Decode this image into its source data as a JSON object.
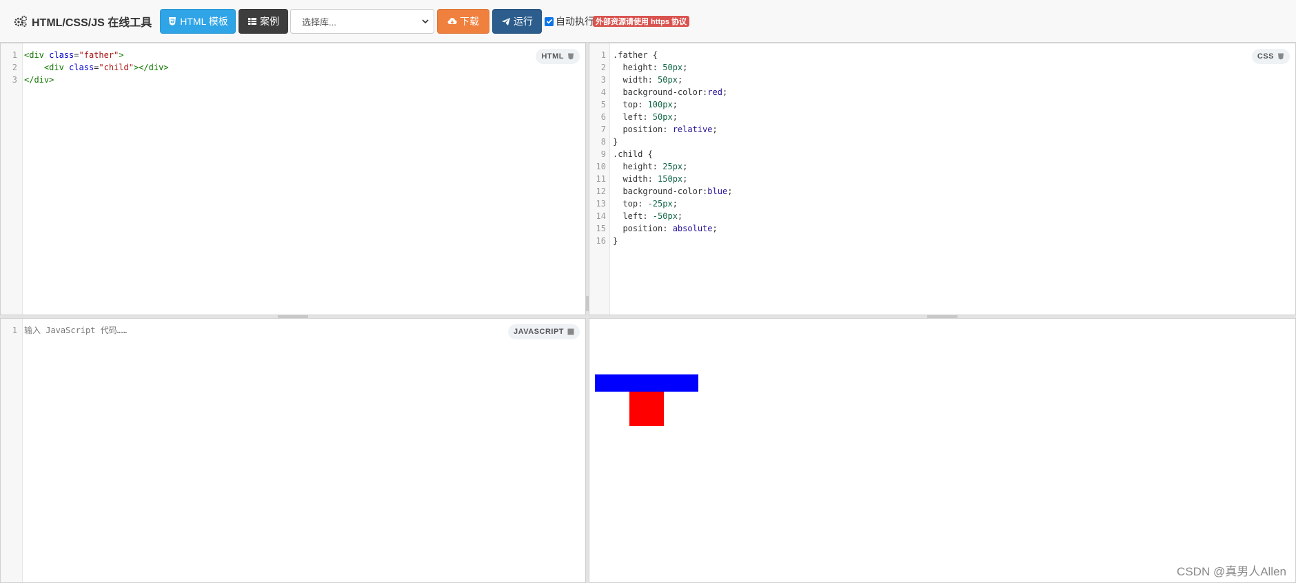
{
  "app": {
    "title": "HTML/CSS/JS 在线工具"
  },
  "toolbar": {
    "template_label": "HTML 模板",
    "examples_label": "案例",
    "library_select_value": "选择库...",
    "download_label": "下载",
    "run_label": "运行",
    "autorun_label": "自动执行",
    "autorun_checked": true,
    "https_badge": "外部资源请使用 https 协议"
  },
  "colors": {
    "template_button": "#2fa4e7",
    "examples_button": "#3d3d3d",
    "download_button": "#f0803d",
    "run_button": "#2c5d8c",
    "https_badge": "#d9534f",
    "father_box": "#ff0000",
    "child_box": "#0000ff"
  },
  "html_editor": {
    "label": "HTML",
    "lines": [
      {
        "n": "1",
        "text": "<div class=\"father\">"
      },
      {
        "n": "2",
        "text": "    <div class=\"child\"></div>"
      },
      {
        "n": "3",
        "text": "</div>"
      }
    ]
  },
  "css_editor": {
    "label": "CSS",
    "lines": [
      {
        "n": "1",
        "text": ".father {"
      },
      {
        "n": "2",
        "text": "  height: 50px;"
      },
      {
        "n": "3",
        "text": "  width: 50px;"
      },
      {
        "n": "4",
        "text": "  background-color:red;"
      },
      {
        "n": "5",
        "text": "  top: 100px;"
      },
      {
        "n": "6",
        "text": "  left: 50px;"
      },
      {
        "n": "7",
        "text": "  position: relative;"
      },
      {
        "n": "8",
        "text": "}"
      },
      {
        "n": "9",
        "text": ".child {"
      },
      {
        "n": "10",
        "text": "  height: 25px;"
      },
      {
        "n": "11",
        "text": "  width: 150px;"
      },
      {
        "n": "12",
        "text": "  background-color:blue;"
      },
      {
        "n": "13",
        "text": "  top: -25px;"
      },
      {
        "n": "14",
        "text": "  left: -50px;"
      },
      {
        "n": "15",
        "text": "  position: absolute;"
      },
      {
        "n": "16",
        "text": "}"
      }
    ]
  },
  "js_editor": {
    "label": "JAVASCRIPT",
    "lines": [
      {
        "n": "1",
        "text": "输入 JavaScript 代码……"
      }
    ]
  },
  "watermark": "CSDN @真男人Allen",
  "icons": {
    "brand": "gears-icon",
    "template": "html5-icon",
    "examples": "table-icon",
    "download": "cloud-download-icon",
    "run": "paper-plane-icon"
  }
}
